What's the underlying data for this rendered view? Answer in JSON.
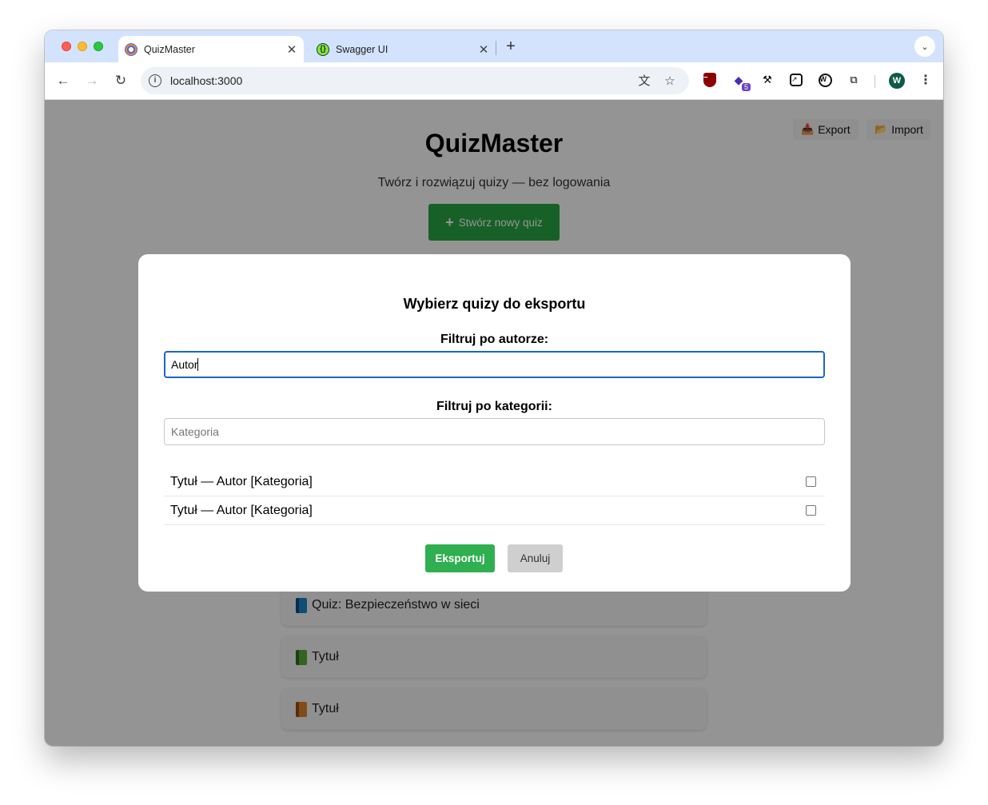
{
  "browser": {
    "tabs": [
      {
        "title": "QuizMaster",
        "icon": "quizmaster-favicon",
        "active": true
      },
      {
        "title": "Swagger UI",
        "icon": "swagger-favicon",
        "active": false
      }
    ],
    "url": "localhost:3000",
    "profile_initial": "W",
    "extension_badge": "5"
  },
  "page": {
    "export_label": "Export",
    "import_label": "Import",
    "title": "QuizMaster",
    "subtitle": "Twórz i rozwiązuj quizy — bez logowania",
    "create_button": "Stwórz nowy quiz",
    "quiz_cards": [
      {
        "title": "Quiz: Bezpieczeństwo w sieci",
        "icon": "blue-book-icon"
      },
      {
        "title": "Tytuł",
        "icon": "green-book-icon"
      },
      {
        "title": "Tytuł",
        "icon": "orange-book-icon"
      }
    ]
  },
  "modal": {
    "title": "Wybierz quizy do eksportu",
    "author_label": "Filtruj po autorze:",
    "author_value": "Autor",
    "category_label": "Filtruj po kategorii:",
    "category_placeholder": "Kategoria",
    "rows": [
      {
        "label": "Tytuł — Autor [Kategoria]",
        "checked": false
      },
      {
        "label": "Tytuł — Autor [Kategoria]",
        "checked": false
      }
    ],
    "export_button": "Eksportuj",
    "cancel_button": "Anuluj"
  },
  "colors": {
    "primary_green": "#28a745",
    "focus_blue": "#1a66c7",
    "tabstrip": "#d3e3fd"
  }
}
